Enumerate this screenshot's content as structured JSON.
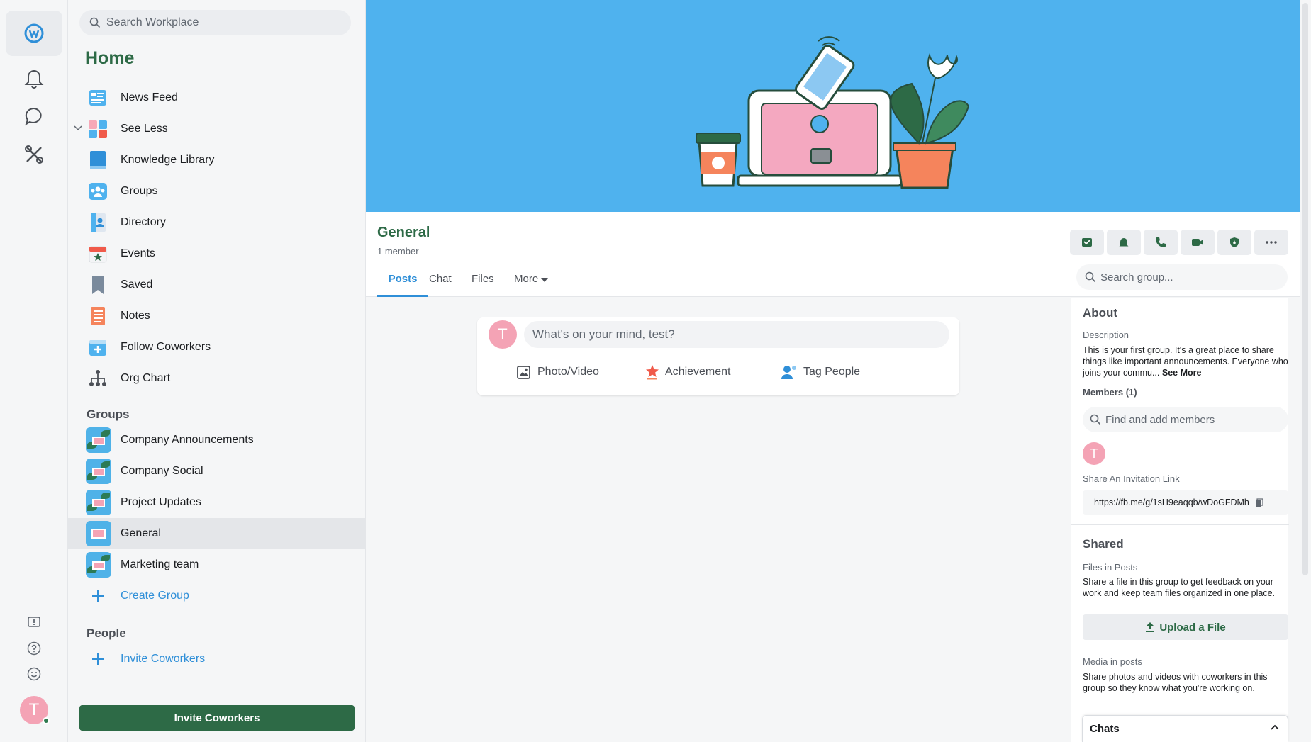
{
  "search": {
    "placeholder": "Search Workplace"
  },
  "sidebar": {
    "home_title": "Home",
    "nav": [
      {
        "label": "News Feed",
        "icon": "news-feed-icon"
      },
      {
        "label": "See Less",
        "icon": "apps-icon"
      },
      {
        "label": "Knowledge Library",
        "icon": "book-icon"
      },
      {
        "label": "Groups",
        "icon": "groups-icon"
      },
      {
        "label": "Directory",
        "icon": "directory-icon"
      },
      {
        "label": "Events",
        "icon": "calendar-star-icon"
      },
      {
        "label": "Saved",
        "icon": "bookmark-icon"
      },
      {
        "label": "Notes",
        "icon": "notes-icon"
      },
      {
        "label": "Follow Coworkers",
        "icon": "follow-icon"
      },
      {
        "label": "Org Chart",
        "icon": "org-chart-icon"
      }
    ],
    "groups_heading": "Groups",
    "groups": [
      {
        "label": "Company Announcements"
      },
      {
        "label": "Company Social"
      },
      {
        "label": "Project Updates"
      },
      {
        "label": "General"
      },
      {
        "label": "Marketing team"
      }
    ],
    "create_group": "Create Group",
    "people_heading": "People",
    "invite_link": "Invite Coworkers",
    "invite_button": "Invite Coworkers"
  },
  "user": {
    "initial": "T"
  },
  "group": {
    "title": "General",
    "members_count": "1 member",
    "tabs": [
      "Posts",
      "Chat",
      "Files",
      "More"
    ],
    "search_placeholder": "Search group..."
  },
  "composer": {
    "placeholder": "What's on your mind, test?",
    "actions": [
      "Photo/Video",
      "Achievement",
      "Tag People"
    ]
  },
  "about": {
    "heading": "About",
    "description_label": "Description",
    "description": "This is your first group. It's a great place to share things like important announcements. Everyone who joins your commu...",
    "see_more": "See More",
    "members_label": "Members (1)",
    "find_members_placeholder": "Find and add members",
    "invite_link_label": "Share An Invitation Link",
    "invite_url": "https://fb.me/g/1sH9eaqqb/wDoGFDMh"
  },
  "shared": {
    "heading": "Shared",
    "files_label": "Files in Posts",
    "files_text": "Share a file in this group to get feedback on your work and keep team files organized in one place.",
    "upload_button": "Upload a File",
    "media_label": "Media in posts",
    "media_text": "Share photos and videos with coworkers in this group so they know what you're working on."
  },
  "chats": {
    "label": "Chats"
  },
  "colors": {
    "brand_green": "#2d6a46",
    "accent_blue": "#2f8fd8",
    "cover_blue": "#4fb2ee",
    "avatar_pink": "#f4a3b5"
  }
}
